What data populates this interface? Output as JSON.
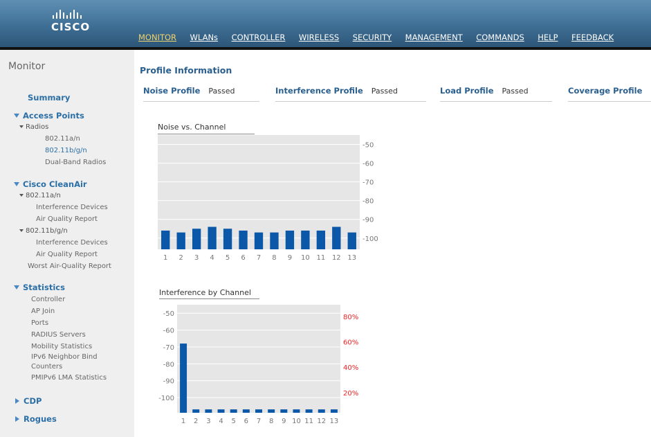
{
  "header": {
    "logo_text": "CISCO",
    "nav": [
      "MONITOR",
      "WLANs",
      "CONTROLLER",
      "WIRELESS",
      "SECURITY",
      "MANAGEMENT",
      "COMMANDS",
      "HELP",
      "FEEDBACK"
    ],
    "active_nav": "MONITOR"
  },
  "sidebar": {
    "title": "Monitor",
    "summary": "Summary",
    "access_points": {
      "label": "Access Points",
      "radios": "Radios",
      "items": [
        "802.11a/n",
        "802.11b/g/n",
        "Dual-Band Radios"
      ],
      "selected": "802.11b/g/n"
    },
    "cleanair": {
      "label": "Cisco CleanAir",
      "band_a": "802.11a/n",
      "band_a_items": [
        "Interference Devices",
        "Air Quality Report"
      ],
      "band_bg": "802.11b/g/n",
      "band_bg_items": [
        "Interference Devices",
        "Air Quality Report"
      ],
      "worst": "Worst Air-Quality Report"
    },
    "statistics": {
      "label": "Statistics",
      "items": [
        "Controller",
        "AP Join",
        "Ports",
        "RADIUS Servers",
        "Mobility Statistics",
        "IPv6 Neighbor Bind",
        "Counters",
        "PMIPv6 LMA Statistics"
      ]
    },
    "cdp": "CDP",
    "rogues": "Rogues"
  },
  "main": {
    "title": "Profile Information",
    "profiles": [
      {
        "label": "Noise Profile",
        "value": "Passed"
      },
      {
        "label": "Interference Profile",
        "value": "Passed"
      },
      {
        "label": "Load Profile",
        "value": "Passed"
      },
      {
        "label": "Coverage Profile",
        "value": ""
      }
    ]
  },
  "chart_data": [
    {
      "type": "bar",
      "title": "Noise vs. Channel",
      "categories": [
        "1",
        "2",
        "3",
        "4",
        "5",
        "6",
        "7",
        "8",
        "9",
        "10",
        "11",
        "12",
        "13"
      ],
      "values": [
        -96,
        -97,
        -95,
        -94,
        -95,
        -96,
        -97,
        -97,
        -96,
        -96,
        -96,
        -94,
        -97
      ],
      "y_ticks": [
        "-50",
        "-60",
        "-70",
        "-80",
        "-90",
        "-100"
      ],
      "ylim": [
        -106,
        -45
      ],
      "y_axis_side": "right",
      "bar_color": "#0b57a8",
      "grid": true
    },
    {
      "type": "bar",
      "title": "Interference by Channel",
      "categories": [
        "1",
        "2",
        "3",
        "4",
        "5",
        "6",
        "7",
        "8",
        "9",
        "10",
        "11",
        "12",
        "13"
      ],
      "values": [
        -68,
        -107,
        -107,
        -107,
        -107,
        -107,
        -107,
        -107,
        -107,
        -107,
        -107,
        -107,
        -107
      ],
      "y_ticks": [
        "-50",
        "-60",
        "-70",
        "-80",
        "-90",
        "-100"
      ],
      "ylim": [
        -109,
        -45
      ],
      "secondary_ticks": [
        "80%",
        "60%",
        "40%",
        "20%"
      ],
      "secondary_values": [
        1,
        0,
        0,
        0,
        0,
        0,
        0,
        0,
        0,
        0,
        0,
        0,
        0
      ],
      "bar_color": "#0b57a8",
      "secondary_color": "#ee2222",
      "grid": true
    }
  ]
}
